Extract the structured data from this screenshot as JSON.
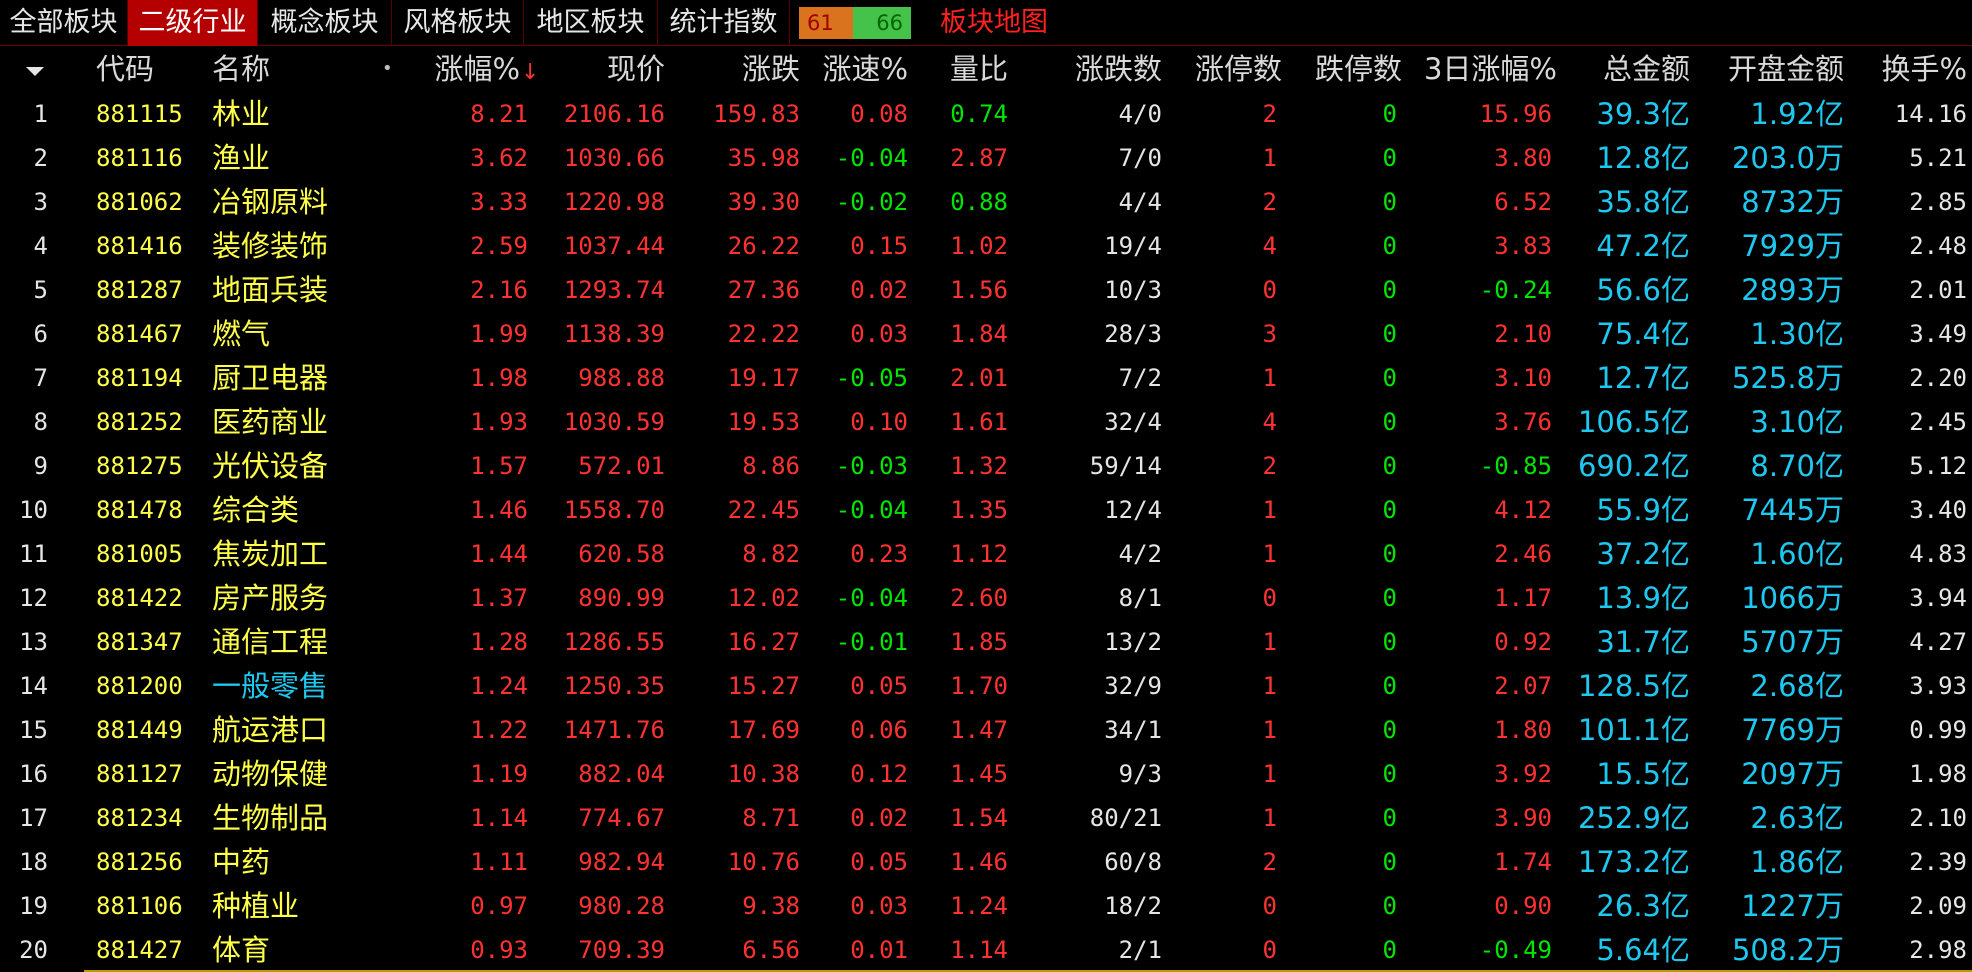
{
  "tabs": [
    {
      "label": "全部板块",
      "active": false
    },
    {
      "label": "二级行业",
      "active": true
    },
    {
      "label": "概念板块",
      "active": false
    },
    {
      "label": "风格板块",
      "active": false
    },
    {
      "label": "地区板块",
      "active": false
    },
    {
      "label": "统计指数",
      "active": false
    }
  ],
  "counters": {
    "up": "61",
    "down": "66"
  },
  "sector_map_label": "板块地图",
  "columns": {
    "code": "代码",
    "name": "名称",
    "dot": "•",
    "pct": "涨幅%",
    "sort_arrow": "↓",
    "price": "现价",
    "change": "涨跌",
    "speed": "涨速%",
    "vol_ratio": "量比",
    "up_down": "涨跌数",
    "limit_up": "涨停数",
    "limit_down": "跌停数",
    "pct3d": "3日涨幅%",
    "amount": "总金额",
    "open_amount": "开盘金额",
    "turnover": "换手%"
  },
  "colors": {
    "red": "#ff3232",
    "green": "#00e600",
    "yellow": "#ffff4a",
    "cyan": "#1ec8f0",
    "active_tab": "#b40000"
  },
  "rows": [
    {
      "idx": "1",
      "code": "881115",
      "name": "林业",
      "pct": "8.21",
      "price": "2106.16",
      "change": "159.83",
      "speed": "0.08",
      "vol_ratio": "0.74",
      "up_down": "4/0",
      "limit_up": "2",
      "limit_down": "0",
      "pct3d": "15.96",
      "amount": "39.3亿",
      "open_amount": "1.92亿",
      "turnover": "14.16"
    },
    {
      "idx": "2",
      "code": "881116",
      "name": "渔业",
      "pct": "3.62",
      "price": "1030.66",
      "change": "35.98",
      "speed": "-0.04",
      "vol_ratio": "2.87",
      "up_down": "7/0",
      "limit_up": "1",
      "limit_down": "0",
      "pct3d": "3.80",
      "amount": "12.8亿",
      "open_amount": "203.0万",
      "turnover": "5.21"
    },
    {
      "idx": "3",
      "code": "881062",
      "name": "冶钢原料",
      "pct": "3.33",
      "price": "1220.98",
      "change": "39.30",
      "speed": "-0.02",
      "vol_ratio": "0.88",
      "up_down": "4/4",
      "limit_up": "2",
      "limit_down": "0",
      "pct3d": "6.52",
      "amount": "35.8亿",
      "open_amount": "8732万",
      "turnover": "2.85"
    },
    {
      "idx": "4",
      "code": "881416",
      "name": "装修装饰",
      "pct": "2.59",
      "price": "1037.44",
      "change": "26.22",
      "speed": "0.15",
      "vol_ratio": "1.02",
      "up_down": "19/4",
      "limit_up": "4",
      "limit_down": "0",
      "pct3d": "3.83",
      "amount": "47.2亿",
      "open_amount": "7929万",
      "turnover": "2.48"
    },
    {
      "idx": "5",
      "code": "881287",
      "name": "地面兵装",
      "pct": "2.16",
      "price": "1293.74",
      "change": "27.36",
      "speed": "0.02",
      "vol_ratio": "1.56",
      "up_down": "10/3",
      "limit_up": "0",
      "limit_down": "0",
      "pct3d": "-0.24",
      "amount": "56.6亿",
      "open_amount": "2893万",
      "turnover": "2.01"
    },
    {
      "idx": "6",
      "code": "881467",
      "name": "燃气",
      "pct": "1.99",
      "price": "1138.39",
      "change": "22.22",
      "speed": "0.03",
      "vol_ratio": "1.84",
      "up_down": "28/3",
      "limit_up": "3",
      "limit_down": "0",
      "pct3d": "2.10",
      "amount": "75.4亿",
      "open_amount": "1.30亿",
      "turnover": "3.49"
    },
    {
      "idx": "7",
      "code": "881194",
      "name": "厨卫电器",
      "pct": "1.98",
      "price": "988.88",
      "change": "19.17",
      "speed": "-0.05",
      "vol_ratio": "2.01",
      "up_down": "7/2",
      "limit_up": "1",
      "limit_down": "0",
      "pct3d": "3.10",
      "amount": "12.7亿",
      "open_amount": "525.8万",
      "turnover": "2.20"
    },
    {
      "idx": "8",
      "code": "881252",
      "name": "医药商业",
      "pct": "1.93",
      "price": "1030.59",
      "change": "19.53",
      "speed": "0.10",
      "vol_ratio": "1.61",
      "up_down": "32/4",
      "limit_up": "4",
      "limit_down": "0",
      "pct3d": "3.76",
      "amount": "106.5亿",
      "open_amount": "3.10亿",
      "turnover": "2.45"
    },
    {
      "idx": "9",
      "code": "881275",
      "name": "光伏设备",
      "pct": "1.57",
      "price": "572.01",
      "change": "8.86",
      "speed": "-0.03",
      "vol_ratio": "1.32",
      "up_down": "59/14",
      "limit_up": "2",
      "limit_down": "0",
      "pct3d": "-0.85",
      "amount": "690.2亿",
      "open_amount": "8.70亿",
      "turnover": "5.12"
    },
    {
      "idx": "10",
      "code": "881478",
      "name": "综合类",
      "pct": "1.46",
      "price": "1558.70",
      "change": "22.45",
      "speed": "-0.04",
      "vol_ratio": "1.35",
      "up_down": "12/4",
      "limit_up": "1",
      "limit_down": "0",
      "pct3d": "4.12",
      "amount": "55.9亿",
      "open_amount": "7445万",
      "turnover": "3.40"
    },
    {
      "idx": "11",
      "code": "881005",
      "name": "焦炭加工",
      "pct": "1.44",
      "price": "620.58",
      "change": "8.82",
      "speed": "0.23",
      "vol_ratio": "1.12",
      "up_down": "4/2",
      "limit_up": "1",
      "limit_down": "0",
      "pct3d": "2.46",
      "amount": "37.2亿",
      "open_amount": "1.60亿",
      "turnover": "4.83"
    },
    {
      "idx": "12",
      "code": "881422",
      "name": "房产服务",
      "pct": "1.37",
      "price": "890.99",
      "change": "12.02",
      "speed": "-0.04",
      "vol_ratio": "2.60",
      "up_down": "8/1",
      "limit_up": "0",
      "limit_down": "0",
      "pct3d": "1.17",
      "amount": "13.9亿",
      "open_amount": "1066万",
      "turnover": "3.94"
    },
    {
      "idx": "13",
      "code": "881347",
      "name": "通信工程",
      "pct": "1.28",
      "price": "1286.55",
      "change": "16.27",
      "speed": "-0.01",
      "vol_ratio": "1.85",
      "up_down": "13/2",
      "limit_up": "1",
      "limit_down": "0",
      "pct3d": "0.92",
      "amount": "31.7亿",
      "open_amount": "5707万",
      "turnover": "4.27"
    },
    {
      "idx": "14",
      "code": "881200",
      "name": "一般零售",
      "pct": "1.24",
      "price": "1250.35",
      "change": "15.27",
      "speed": "0.05",
      "vol_ratio": "1.70",
      "up_down": "32/9",
      "limit_up": "1",
      "limit_down": "0",
      "pct3d": "2.07",
      "amount": "128.5亿",
      "open_amount": "2.68亿",
      "turnover": "3.93",
      "name_color": "cyan"
    },
    {
      "idx": "15",
      "code": "881449",
      "name": "航运港口",
      "pct": "1.22",
      "price": "1471.76",
      "change": "17.69",
      "speed": "0.06",
      "vol_ratio": "1.47",
      "up_down": "34/1",
      "limit_up": "1",
      "limit_down": "0",
      "pct3d": "1.80",
      "amount": "101.1亿",
      "open_amount": "7769万",
      "turnover": "0.99"
    },
    {
      "idx": "16",
      "code": "881127",
      "name": "动物保健",
      "pct": "1.19",
      "price": "882.04",
      "change": "10.38",
      "speed": "0.12",
      "vol_ratio": "1.45",
      "up_down": "9/3",
      "limit_up": "1",
      "limit_down": "0",
      "pct3d": "3.92",
      "amount": "15.5亿",
      "open_amount": "2097万",
      "turnover": "1.98"
    },
    {
      "idx": "17",
      "code": "881234",
      "name": "生物制品",
      "pct": "1.14",
      "price": "774.67",
      "change": "8.71",
      "speed": "0.02",
      "vol_ratio": "1.54",
      "up_down": "80/21",
      "limit_up": "1",
      "limit_down": "0",
      "pct3d": "3.90",
      "amount": "252.9亿",
      "open_amount": "2.63亿",
      "turnover": "2.10"
    },
    {
      "idx": "18",
      "code": "881256",
      "name": "中药",
      "pct": "1.11",
      "price": "982.94",
      "change": "10.76",
      "speed": "0.05",
      "vol_ratio": "1.46",
      "up_down": "60/8",
      "limit_up": "2",
      "limit_down": "0",
      "pct3d": "1.74",
      "amount": "173.2亿",
      "open_amount": "1.86亿",
      "turnover": "2.39"
    },
    {
      "idx": "19",
      "code": "881106",
      "name": "种植业",
      "pct": "0.97",
      "price": "980.28",
      "change": "9.38",
      "speed": "0.03",
      "vol_ratio": "1.24",
      "up_down": "18/2",
      "limit_up": "0",
      "limit_down": "0",
      "pct3d": "0.90",
      "amount": "26.3亿",
      "open_amount": "1227万",
      "turnover": "2.09"
    },
    {
      "idx": "20",
      "code": "881427",
      "name": "体育",
      "pct": "0.93",
      "price": "709.39",
      "change": "6.56",
      "speed": "0.01",
      "vol_ratio": "1.14",
      "up_down": "2/1",
      "limit_up": "0",
      "limit_down": "0",
      "pct3d": "-0.49",
      "amount": "5.64亿",
      "open_amount": "508.2万",
      "turnover": "2.98"
    }
  ]
}
